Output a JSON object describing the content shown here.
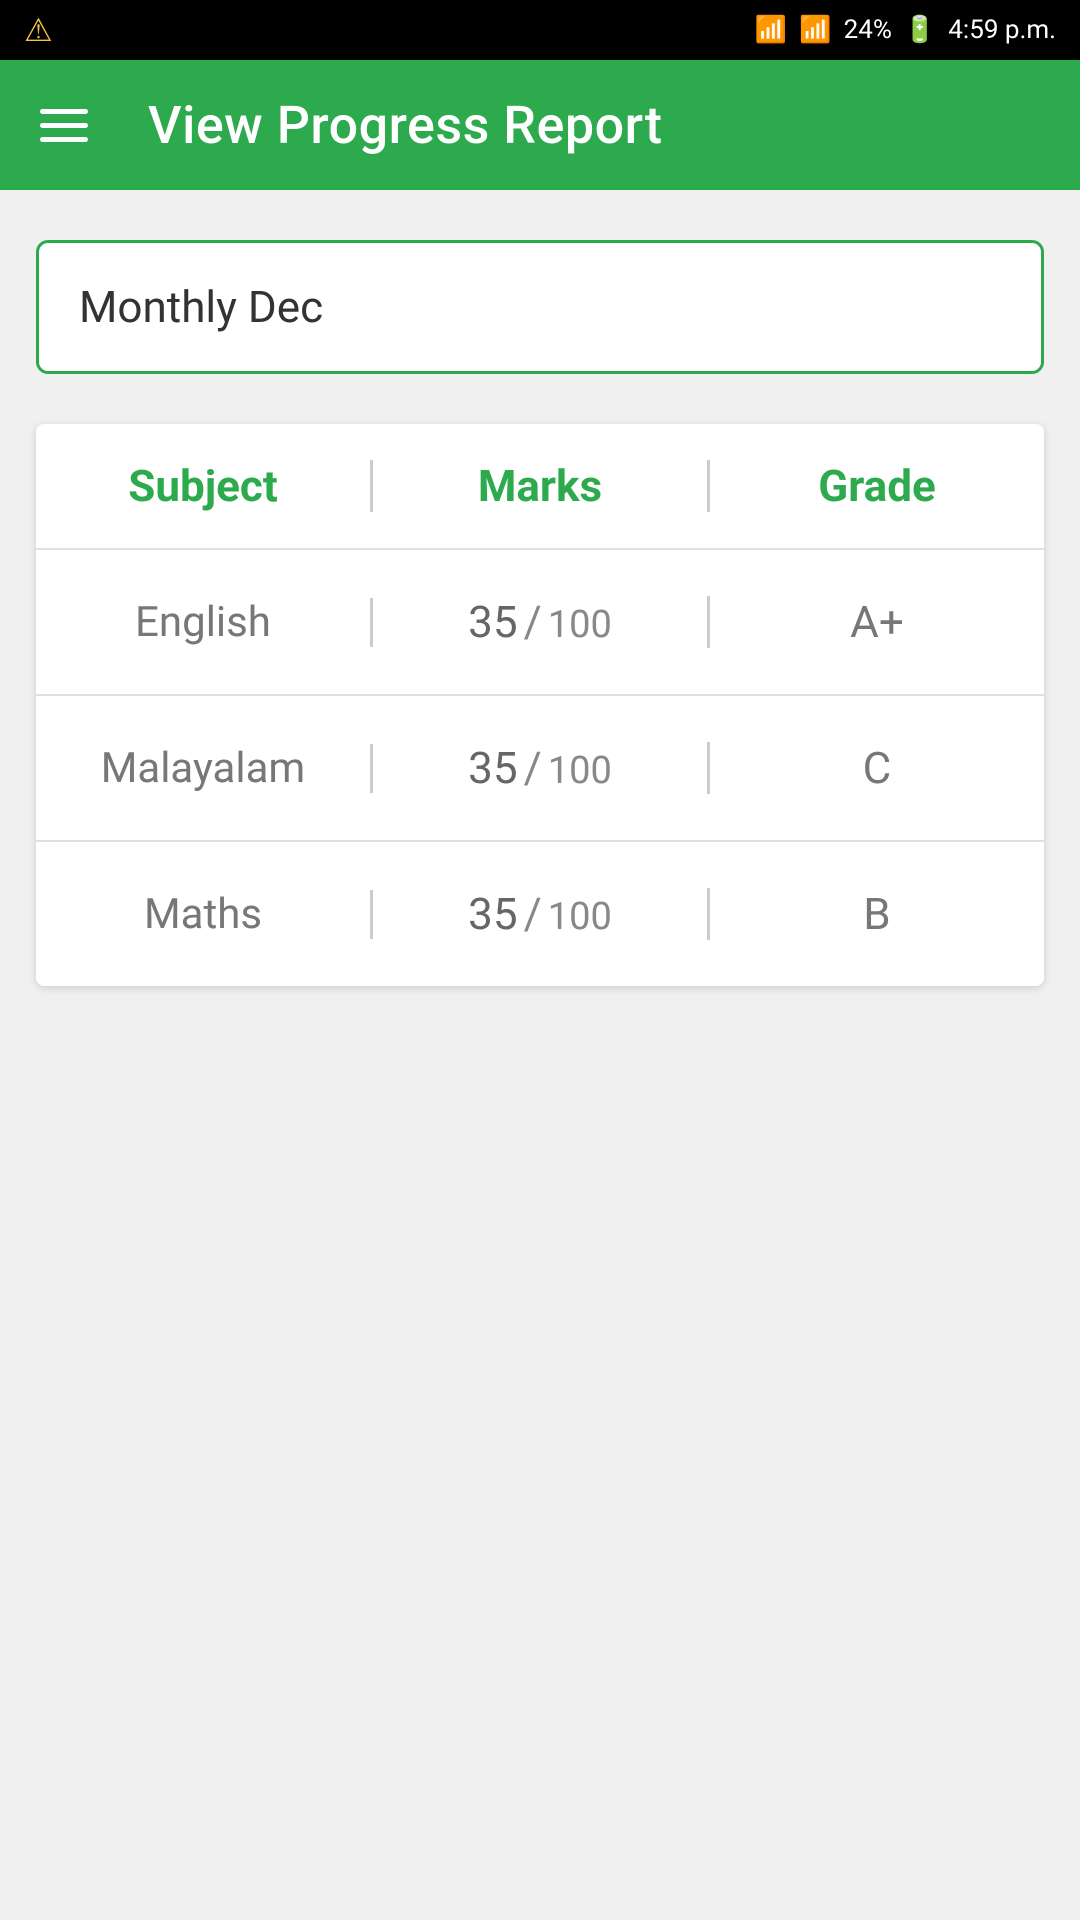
{
  "statusBar": {
    "battery": "24%",
    "time": "4:59 p.m."
  },
  "header": {
    "title": "View Progress Report",
    "menuIcon": "hamburger-icon"
  },
  "selector": {
    "value": "Monthly Dec",
    "placeholder": "Monthly Dec"
  },
  "table": {
    "columns": {
      "subject": "Subject",
      "marks": "Marks",
      "grade": "Grade"
    },
    "rows": [
      {
        "subject": "English",
        "score": "35",
        "slash": "/",
        "total": "100",
        "grade": "A+"
      },
      {
        "subject": "Malayalam",
        "score": "35",
        "slash": "/",
        "total": "100",
        "grade": "C"
      },
      {
        "subject": "Maths",
        "score": "35",
        "slash": "/",
        "total": "100",
        "grade": "B"
      }
    ]
  }
}
